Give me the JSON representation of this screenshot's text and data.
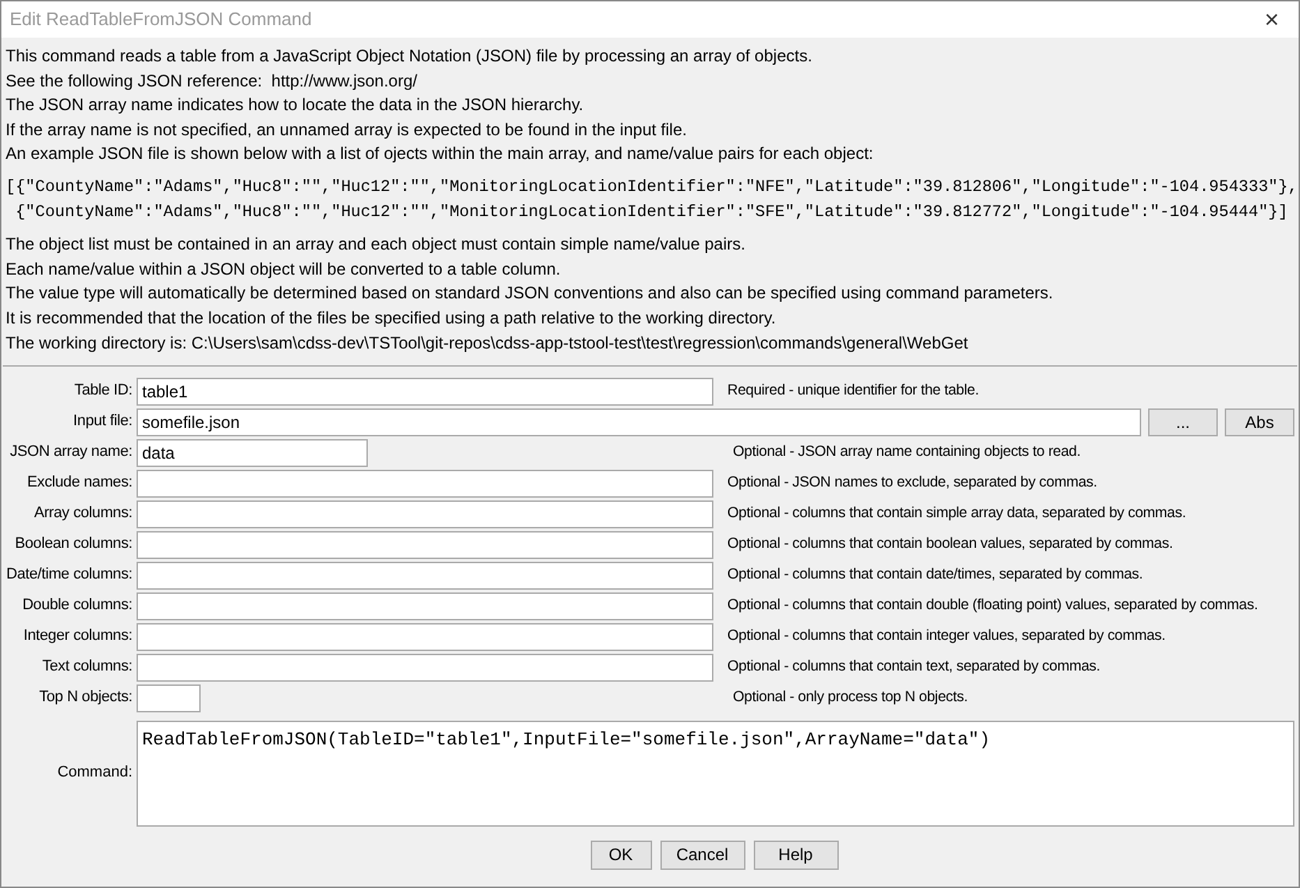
{
  "window": {
    "title": "Edit ReadTableFromJSON Command",
    "close": "×"
  },
  "info": [
    {
      "kind": "text",
      "text": "This command reads a table from a JavaScript Object Notation (JSON) file by processing an array of objects."
    },
    {
      "kind": "text",
      "text": "See the following JSON reference:  http://www.json.org/"
    },
    {
      "kind": "text",
      "text": "The JSON array name indicates how to locate the data in the JSON hierarchy."
    },
    {
      "kind": "text",
      "text": "If the array name is not specified, an unnamed array is expected to be found in the input file."
    },
    {
      "kind": "text",
      "text": "An example JSON file is shown below with a list of ojects within the main array, and name/value pairs for each object:"
    },
    {
      "kind": "code",
      "text": "[{\"CountyName\":\"Adams\",\"Huc8\":\"\",\"Huc12\":\"\",\"MonitoringLocationIdentifier\":\"NFE\",\"Latitude\":\"39.812806\",\"Longitude\":\"-104.954333\"},"
    },
    {
      "kind": "code",
      "text": " {\"CountyName\":\"Adams\",\"Huc8\":\"\",\"Huc12\":\"\",\"MonitoringLocationIdentifier\":\"SFE\",\"Latitude\":\"39.812772\",\"Longitude\":\"-104.95444\"}]"
    },
    {
      "kind": "text",
      "text": "The object list must be contained in an array and each object must contain simple name/value pairs."
    },
    {
      "kind": "text",
      "text": "Each name/value within a JSON object will be converted to a table column."
    },
    {
      "kind": "text",
      "text": "The value type will automatically be determined based on standard JSON conventions and also can be specified using command parameters."
    },
    {
      "kind": "text",
      "text": "It is recommended that the location of the files be specified using a path relative to the working directory."
    },
    {
      "kind": "text",
      "text": "The working directory is: C:\\Users\\sam\\cdss-dev\\TSTool\\git-repos\\cdss-app-tstool-test\\test\\regression\\commands\\general\\WebGet"
    }
  ],
  "fields": [
    {
      "label": "Table ID:",
      "value": "table1",
      "kind": "wide",
      "description": "Required - unique identifier for the table."
    },
    {
      "label": "Input file:",
      "value": "somefile.json",
      "kind": "file",
      "buttons": [
        "...",
        "Abs"
      ]
    },
    {
      "label": "JSON array name:",
      "value": "data",
      "kind": "short",
      "description": "Optional - JSON array name containing objects to read."
    },
    {
      "label": "Exclude names:",
      "kind": "wide",
      "description": "Optional - JSON names to exclude, separated by commas."
    },
    {
      "label": "Array columns:",
      "kind": "wide",
      "description": "Optional - columns that contain simple array data, separated by commas."
    },
    {
      "label": "Boolean columns:",
      "kind": "wide",
      "description": "Optional - columns that contain boolean values, separated by commas."
    },
    {
      "label": "Date/time columns:",
      "kind": "wide",
      "description": "Optional - columns that contain date/times, separated by commas."
    },
    {
      "label": "Double columns:",
      "kind": "wide",
      "description": "Optional - columns that contain double (floating point) values, separated by commas."
    },
    {
      "label": "Integer columns:",
      "kind": "wide",
      "description": "Optional - columns that contain integer values, separated by commas."
    },
    {
      "label": "Text columns:",
      "kind": "wide",
      "description": "Optional - columns that contain text, separated by commas."
    },
    {
      "label": "Top N objects:",
      "kind": "tiny",
      "description": "Optional - only process top N objects."
    }
  ],
  "command": {
    "label": "Command:",
    "value": "ReadTableFromJSON(TableID=\"table1\",InputFile=\"somefile.json\",ArrayName=\"data\")"
  },
  "buttons": [
    "OK",
    "Cancel",
    "Help"
  ]
}
